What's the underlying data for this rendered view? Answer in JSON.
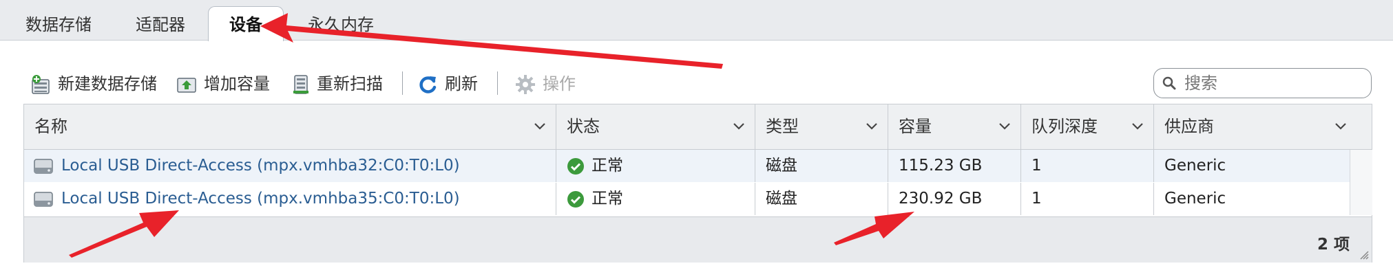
{
  "tabs": [
    {
      "label": "数据存储",
      "active": false
    },
    {
      "label": "适配器",
      "active": false
    },
    {
      "label": "设备",
      "active": true
    },
    {
      "label": "永久内存",
      "active": false
    }
  ],
  "toolbar": {
    "new_datastore": "新建数据存储",
    "increase_capacity": "增加容量",
    "rescan": "重新扫描",
    "refresh": "刷新",
    "actions": "操作"
  },
  "search": {
    "placeholder": "搜索",
    "value": ""
  },
  "table": {
    "columns": [
      "名称",
      "状态",
      "类型",
      "容量",
      "队列深度",
      "供应商"
    ],
    "rows": [
      {
        "name": "Local USB Direct-Access (mpx.vmhba32:C0:T0:L0)",
        "status": "正常",
        "type": "磁盘",
        "capacity": "115.23 GB",
        "queue_depth": "1",
        "vendor": "Generic"
      },
      {
        "name": "Local USB Direct-Access (mpx.vmhba35:C0:T0:L0)",
        "status": "正常",
        "type": "磁盘",
        "capacity": "230.92 GB",
        "queue_depth": "1",
        "vendor": "Generic"
      }
    ],
    "footer_count": "2 项"
  },
  "colors": {
    "accent_link": "#2a5d92",
    "status_ok": "#3c9a3c",
    "annotation_arrow": "#e8222a",
    "header_bg": "#eef0f2",
    "selected_row_bg": "#eef3f9"
  },
  "icons": {
    "new_datastore": "database-add-icon",
    "increase_capacity": "capacity-increase-icon",
    "rescan": "rescan-icon",
    "refresh": "refresh-icon",
    "actions": "gear-icon",
    "search": "search-icon",
    "row_device": "disk-drive-icon",
    "status": "check-circle-icon",
    "column_menu": "chevron-down-icon"
  }
}
